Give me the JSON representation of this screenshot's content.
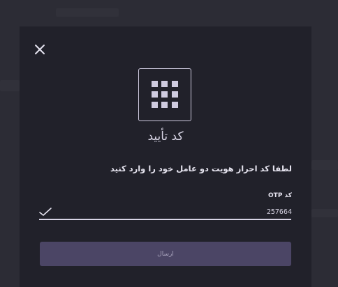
{
  "modal": {
    "close_icon": "close-icon",
    "header_icon": "grid-keypad-icon",
    "title": "کد تأیید",
    "instruction": "لطفا کد احراز هویت دو عامل خود را وارد کنید",
    "otp_field": {
      "label": "کد OTP",
      "value": "257664",
      "valid_icon": "checkmark-icon"
    },
    "submit_label": "ارسال"
  },
  "colors": {
    "backdrop": "#2c2c35",
    "modal_bg": "#21212a",
    "accent_button": "#4b4565",
    "text_primary": "#e6e4ef"
  }
}
